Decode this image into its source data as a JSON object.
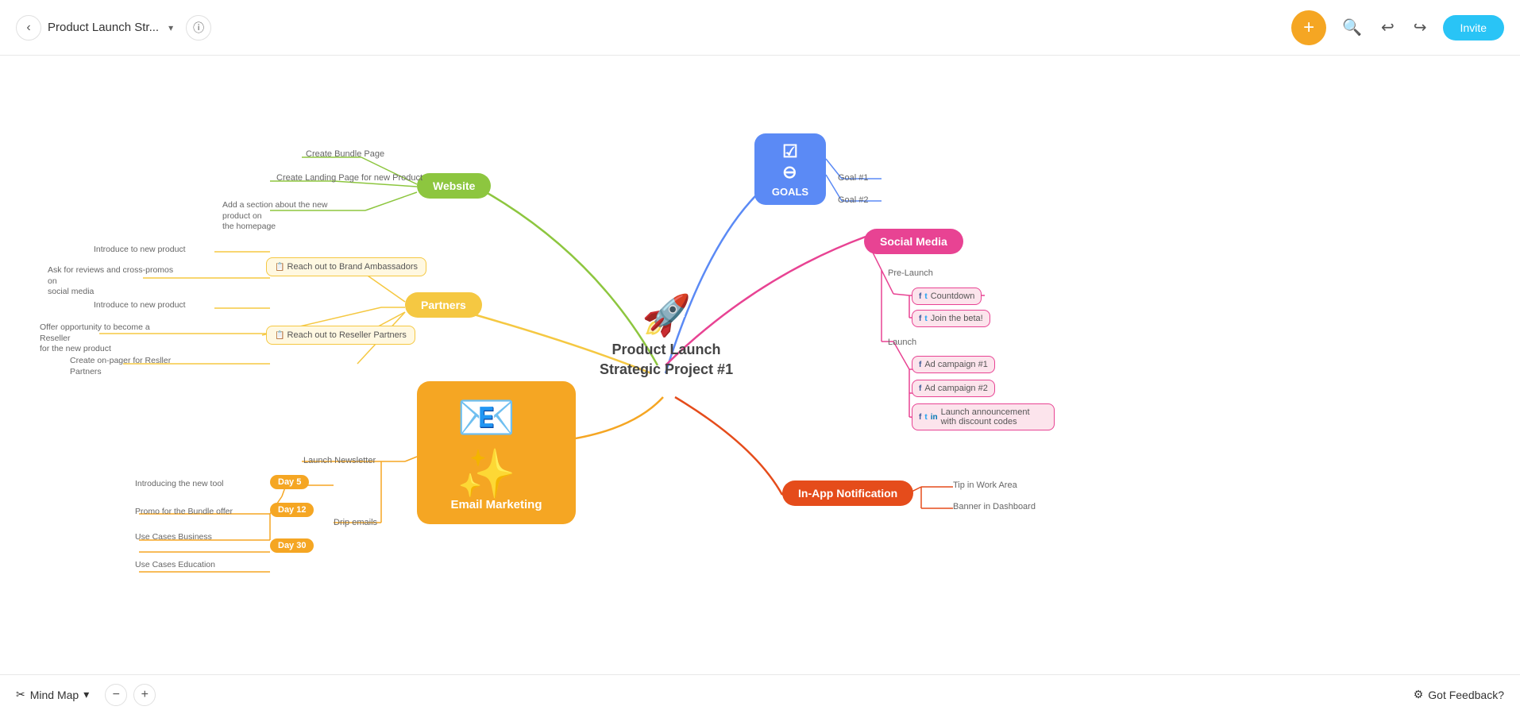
{
  "header": {
    "back_label": "‹",
    "project_title": "Product Launch Str...",
    "dropdown_icon": "▾",
    "info_icon": "ⓘ",
    "add_icon": "+",
    "search_icon": "🔍",
    "undo_icon": "↩",
    "redo_icon": "↪",
    "invite_label": "Invite"
  },
  "footer": {
    "mindmap_icon": "✂",
    "mindmap_label": "Mind Map",
    "dropdown_icon": "▾",
    "zoom_out": "−",
    "zoom_in": "+",
    "feedback_label": "Got Feedback?"
  },
  "mindmap": {
    "center_title": "Product Launch\nStrategic Project #1",
    "goals_label": "GOALS",
    "goals_item1": "Goal #1",
    "goals_item2": "Goal #2",
    "website_label": "Website",
    "website_items": [
      "Create Bundle Page",
      "Create Landing Page for new Product",
      "Add a section about the new product on\nthe homepage"
    ],
    "partners_label": "Partners",
    "partners_items": [
      "Introduce to new product",
      "Ask for reviews and cross-promos on\nsocial media",
      "Introduce to new product",
      "Offer opportunity to become a Reseller\nfor the new product",
      "Create on-pager for Resller Partners"
    ],
    "partners_sub1": "Reach out to Brand Ambassadors",
    "partners_sub2": "Reach out to Reseller Partners",
    "social_media_label": "Social Media",
    "social_prelaunch": "Pre-Launch",
    "social_launch": "Launch",
    "social_items": [
      "Countdown",
      "Join the beta!",
      "Ad campaign #1",
      "Ad campaign #2",
      "Launch announcement with\ndiscount codes"
    ],
    "email_label": "Email Marketing",
    "email_sub1": "Launch Newsletter",
    "email_sub2": "Drip emails",
    "email_day_items": [
      {
        "label": "Introducing the new tool",
        "day": "Day 5"
      },
      {
        "label": "Promo for the Bundle offer",
        "day": "Day 12"
      },
      {
        "label": "Use Cases Business",
        "day": "Day 30"
      },
      {
        "label": "Use Cases Education",
        "day": "Day 30"
      }
    ],
    "inapp_label": "In-App Notification",
    "inapp_items": [
      "Tip in Work Area",
      "Banner in Dashboard"
    ]
  },
  "colors": {
    "goals_bg": "#5b8af5",
    "website_bg": "#8dc63f",
    "partners_bg": "#f5c842",
    "social_bg": "#e84393",
    "email_bg": "#f5a623",
    "inapp_bg": "#e54c1b",
    "add_btn": "#f5a623",
    "invite_btn": "#29c4f6"
  }
}
